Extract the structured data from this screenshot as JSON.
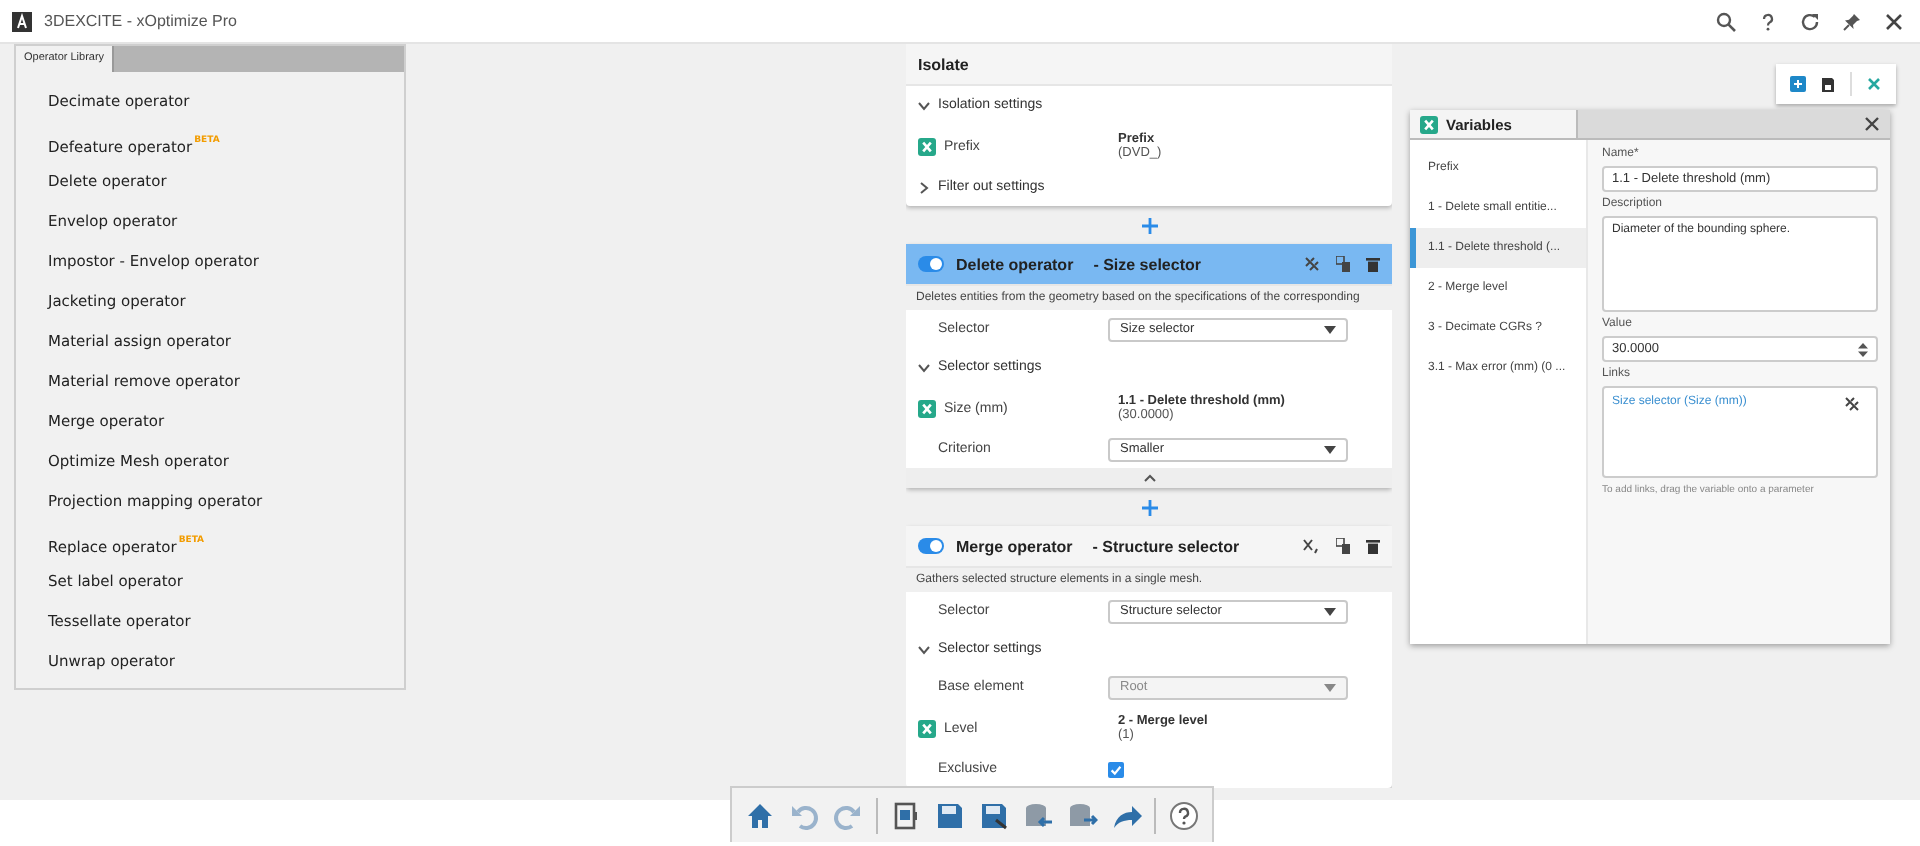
{
  "window": {
    "title": "3DEXCITE - xOptimize Pro"
  },
  "library": {
    "tab": "Operator Library",
    "items": [
      {
        "label": "Decimate operator"
      },
      {
        "label": "Defeature operator",
        "badge": "BETA"
      },
      {
        "label": "Delete operator"
      },
      {
        "label": "Envelop operator"
      },
      {
        "label": "Impostor - Envelop operator"
      },
      {
        "label": "Jacketing operator"
      },
      {
        "label": "Material assign operator"
      },
      {
        "label": "Material remove operator"
      },
      {
        "label": "Merge operator"
      },
      {
        "label": "Optimize Mesh operator"
      },
      {
        "label": "Projection mapping operator"
      },
      {
        "label": "Replace operator",
        "badge": "BETA"
      },
      {
        "label": "Set label operator"
      },
      {
        "label": "Tessellate operator"
      },
      {
        "label": "Unwrap operator"
      }
    ]
  },
  "operators": [
    {
      "kind": "group",
      "title": "Isolate",
      "rows": [
        {
          "kind": "section",
          "label": "Isolation settings",
          "expanded": true
        },
        {
          "kind": "variable",
          "label": "Prefix",
          "var_name": "Prefix",
          "var_value": "(DVD_)"
        },
        {
          "kind": "section",
          "label": "Filter out settings",
          "expanded": false
        }
      ]
    },
    {
      "kind": "operator",
      "title": "Delete operator",
      "subtitle": "- Size selector",
      "enabled": true,
      "selected": true,
      "linked": true,
      "collapse_button": true,
      "description": "Deletes entities from the geometry based on the specifications of the corresponding",
      "rows": [
        {
          "kind": "dropdown",
          "label": "Selector",
          "value": "Size selector",
          "disabled": false
        },
        {
          "kind": "section",
          "label": "Selector settings",
          "expanded": true
        },
        {
          "kind": "variable",
          "label": "Size (mm)",
          "var_name": "1.1 - Delete threshold (mm)",
          "var_value": "(30.0000)"
        },
        {
          "kind": "dropdown",
          "label": "Criterion",
          "value": "Smaller",
          "disabled": false
        }
      ]
    },
    {
      "kind": "operator",
      "title": "Merge operator",
      "subtitle": "- Structure selector",
      "enabled": true,
      "selected": false,
      "linked": false,
      "description": "Gathers selected structure elements in a single mesh.",
      "rows": [
        {
          "kind": "dropdown",
          "label": "Selector",
          "value": "Structure selector",
          "disabled": false
        },
        {
          "kind": "section",
          "label": "Selector settings",
          "expanded": true
        },
        {
          "kind": "dropdown",
          "label": "Base element",
          "value": "Root",
          "disabled": true
        },
        {
          "kind": "variable",
          "label": "Level",
          "var_name": "2 - Merge level",
          "var_value": "(1)"
        },
        {
          "kind": "checkbox",
          "label": "Exclusive",
          "checked": true
        }
      ]
    }
  ],
  "variables": {
    "title": "Variables",
    "items": [
      {
        "label": "Prefix",
        "selected": false
      },
      {
        "label": "1 - Delete small entitie...",
        "selected": false
      },
      {
        "label": "1.1 - Delete threshold (...",
        "selected": true
      },
      {
        "label": "2 - Merge level",
        "selected": false
      },
      {
        "label": "3 - Decimate CGRs ?",
        "selected": false
      },
      {
        "label": "3.1 - Max error (mm) (0 ...",
        "selected": false
      }
    ],
    "name_label": "Name*",
    "name": "1.1 - Delete threshold (mm)",
    "description_label": "Description",
    "description": "Diameter of the bounding sphere.",
    "value_label": "Value",
    "value": "30.0000",
    "links_label": "Links",
    "links": [
      "Size selector (Size (mm))"
    ],
    "hint": "To add links, drag the variable onto a parameter"
  }
}
